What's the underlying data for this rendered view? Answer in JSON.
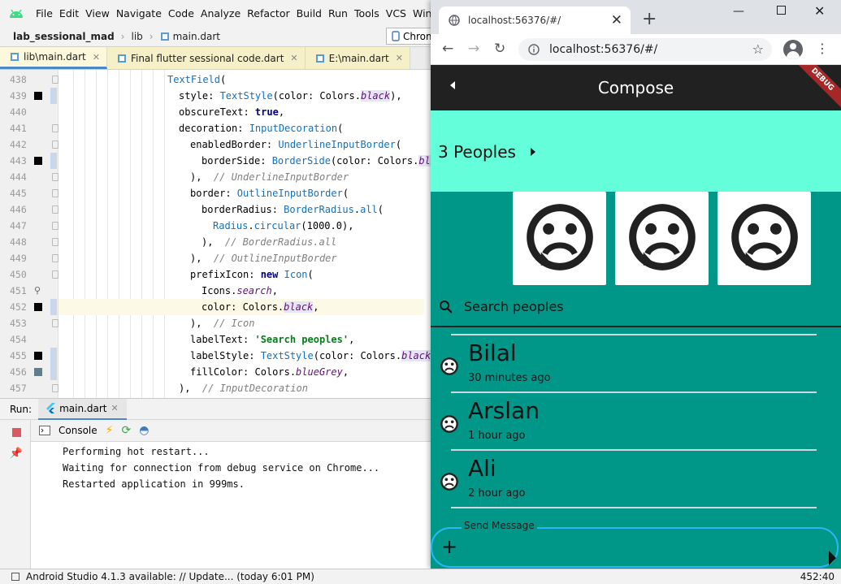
{
  "menu": [
    "File",
    "Edit",
    "View",
    "Navigate",
    "Code",
    "Analyze",
    "Refactor",
    "Build",
    "Run",
    "Tools",
    "VCS",
    "Windo"
  ],
  "breadcrumb": {
    "project": "lab_sessional_mad",
    "folder": "lib",
    "file": "main.dart",
    "run_config": "Chrom"
  },
  "editor_tabs": [
    {
      "label": "lib\\main.dart",
      "active": true
    },
    {
      "label": "Final flutter sessional code.dart",
      "active": false
    },
    {
      "label": "E:\\main.dart",
      "active": false
    }
  ],
  "code_lines": [
    {
      "n": "438",
      "indent": 9,
      "html": "<span class='t'>TextField</span>("
    },
    {
      "n": "439",
      "indent": 10,
      "html": "style: <span class='t'>TextStyle</span>(color: Colors.<span class='p'>black</span>),"
    },
    {
      "n": "440",
      "indent": 10,
      "html": "obscureText: <span class='k'>true</span>,"
    },
    {
      "n": "441",
      "indent": 10,
      "html": "decoration: <span class='t'>InputDecoration</span>("
    },
    {
      "n": "442",
      "indent": 11,
      "html": "enabledBorder: <span class='t'>UnderlineInputBorder</span>("
    },
    {
      "n": "443",
      "indent": 12,
      "html": "borderSide: <span class='t'>BorderSide</span>(color: Colors.<span class='p'>black</span>),"
    },
    {
      "n": "444",
      "indent": 11,
      "html": "),  <span class='c'>// UnderlineInputBorder</span>"
    },
    {
      "n": "445",
      "indent": 11,
      "html": "border: <span class='t'>OutlineInputBorder</span>("
    },
    {
      "n": "446",
      "indent": 12,
      "html": "borderRadius: <span class='t'>BorderRadius</span>.<span class='t'>all</span>("
    },
    {
      "n": "447",
      "indent": 13,
      "html": "<span class='t'>Radius</span>.<span class='t'>circular</span>(1000.0),"
    },
    {
      "n": "448",
      "indent": 12,
      "html": "),  <span class='c'>// BorderRadius.all</span>"
    },
    {
      "n": "449",
      "indent": 11,
      "html": "),  <span class='c'>// OutlineInputBorder</span>"
    },
    {
      "n": "450",
      "indent": 11,
      "html": "prefixIcon: <span class='k'>new</span> <span class='t'>Icon</span>("
    },
    {
      "n": "451",
      "indent": 12,
      "html": "Icons.<span class='bl'>search</span>,"
    },
    {
      "n": "452",
      "indent": 12,
      "html": "color: Colors.<span class='p'>black</span>,"
    },
    {
      "n": "453",
      "indent": 11,
      "html": "),  <span class='c'>// Icon</span>"
    },
    {
      "n": "454",
      "indent": 11,
      "html": "labelText: <span class='s'>'Search peoples'</span>,"
    },
    {
      "n": "455",
      "indent": 11,
      "html": "labelStyle: <span class='t'>TextStyle</span>(color: Colors.<span class='p'>black</span>),"
    },
    {
      "n": "456",
      "indent": 11,
      "html": "fillColor: Colors.<span class='bl'>blueGrey</span>,"
    },
    {
      "n": "457",
      "indent": 10,
      "html": "),  <span class='c'>// InputDecoration</span>"
    }
  ],
  "run_panel": {
    "label": "Run:",
    "tab": "main.dart",
    "console_label": "Console"
  },
  "console_lines": [
    "Performing hot restart...",
    "Waiting for connection from debug service on Chrome...",
    "Restarted application in 999ms."
  ],
  "status": {
    "message": "Android Studio 4.1.3 available: // Update... (today 6:01 PM)",
    "position": "452:40"
  },
  "browser": {
    "tab_title": "localhost:56376/#/",
    "url": "localhost:56376/#/"
  },
  "app": {
    "title": "Compose",
    "debug_banner": "DEBUG",
    "people_label": "3 Peoples",
    "search_label": "Search peoples",
    "messages": [
      {
        "name": "Bilal",
        "time": "30 minutes ago"
      },
      {
        "name": "Arslan",
        "time": "1 hour ago"
      },
      {
        "name": "Ali",
        "time": "2 hour ago"
      }
    ],
    "send_label": "Send Message",
    "colors": {
      "appbar": "#212121",
      "people_bar": "#64ffda",
      "body": "#009688",
      "send_border": "#29b6f6"
    }
  }
}
